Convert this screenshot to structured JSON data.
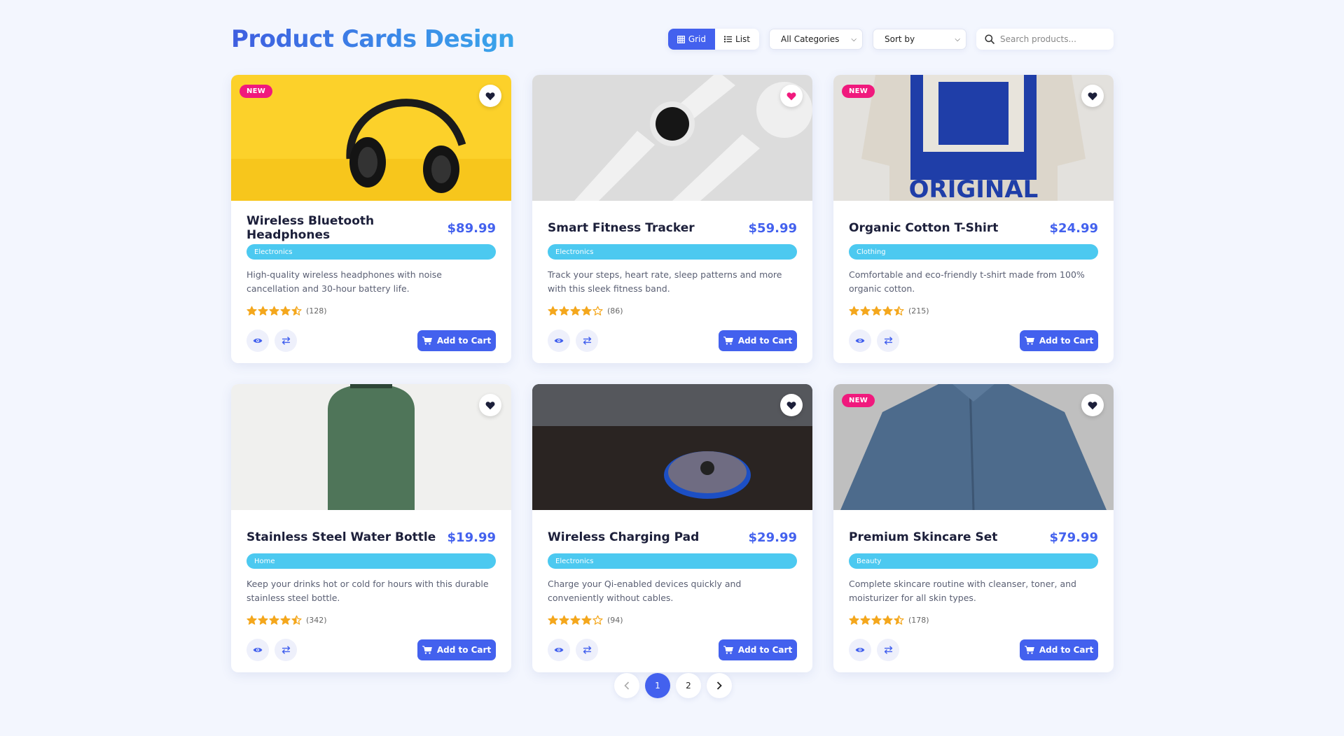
{
  "header": {
    "title": "Product Cards Design",
    "view": {
      "grid_label": "Grid",
      "list_label": "List",
      "active": "grid"
    },
    "category_select": {
      "value": "All Categories"
    },
    "sort_select": {
      "value": "Sort by"
    },
    "search": {
      "placeholder": "Search products..."
    }
  },
  "colors": {
    "accent": "#4361ee",
    "category_badge": "#4cc9f0",
    "new_badge": "#f0197d",
    "star": "#f4a71d"
  },
  "products": [
    {
      "name": "Wireless Bluetooth Headphones",
      "price": "$89.99",
      "category": "Electronics",
      "description": "High-quality wireless headphones with noise cancellation and 30-hour battery life.",
      "rating": 4.5,
      "reviews": "(128)",
      "badge": "NEW",
      "favorited": false,
      "image": "headphones-on-yellow"
    },
    {
      "name": "Smart Fitness Tracker",
      "price": "$59.99",
      "category": "Electronics",
      "description": "Track your steps, heart rate, sleep patterns and more with this sleek fitness band.",
      "rating": 4,
      "reviews": "(86)",
      "badge": "",
      "favorited": true,
      "image": "white-smartwatch"
    },
    {
      "name": "Organic Cotton T-Shirt",
      "price": "$24.99",
      "category": "Clothing",
      "description": "Comfortable and eco-friendly t-shirt made from 100% organic cotton.",
      "rating": 4.5,
      "reviews": "(215)",
      "badge": "NEW",
      "favorited": false,
      "image": "printed-tshirt"
    },
    {
      "name": "Stainless Steel Water Bottle",
      "price": "$19.99",
      "category": "Home",
      "description": "Keep your drinks hot or cold for hours with this durable stainless steel bottle.",
      "rating": 4.5,
      "reviews": "(342)",
      "badge": "",
      "favorited": false,
      "image": "green-bottle"
    },
    {
      "name": "Wireless Charging Pad",
      "price": "$29.99",
      "category": "Electronics",
      "description": "Charge your Qi-enabled devices quickly and conveniently without cables.",
      "rating": 4,
      "reviews": "(94)",
      "badge": "",
      "favorited": false,
      "image": "charging-pad"
    },
    {
      "name": "Premium Skincare Set",
      "price": "$79.99",
      "category": "Beauty",
      "description": "Complete skincare routine with cleanser, toner, and moisturizer for all skin types.",
      "rating": 4.5,
      "reviews": "(178)",
      "badge": "NEW",
      "favorited": false,
      "image": "denim-shirt"
    }
  ],
  "card_labels": {
    "add_to_cart": "Add to Cart"
  },
  "pagination": {
    "pages": [
      "1",
      "2"
    ],
    "current": "1"
  }
}
